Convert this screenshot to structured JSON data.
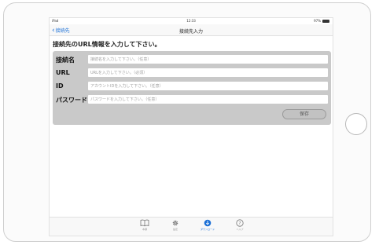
{
  "status": {
    "left": "iPad",
    "time": "12:33",
    "battery": "97%",
    "battery_level": 0.97
  },
  "nav": {
    "back_label": "接続先",
    "title": "接続先入力"
  },
  "instruction": "接続先のURL情報を入力して下さい。",
  "form": {
    "fields": [
      {
        "label": "接続名",
        "placeholder": "接続名を入力して下さい。（任意）"
      },
      {
        "label": "URL",
        "placeholder": "URLを入力して下さい。（必須）"
      },
      {
        "label": "ID",
        "placeholder": "アカウントIDを入力して下さい。（任意）"
      },
      {
        "label": "パスワード",
        "placeholder": "パスワードを入力して下さい。（任意）"
      }
    ],
    "save_label": "保存"
  },
  "tabs": [
    {
      "label": "本棚",
      "icon": "book-icon"
    },
    {
      "label": "設定",
      "icon": "gear-icon"
    },
    {
      "label": "ダウンロード",
      "icon": "download-icon"
    },
    {
      "label": "ヘルプ",
      "icon": "help-icon"
    }
  ],
  "colors": {
    "accent": "#1a6fd6",
    "form_bg": "#c9c9c9"
  }
}
